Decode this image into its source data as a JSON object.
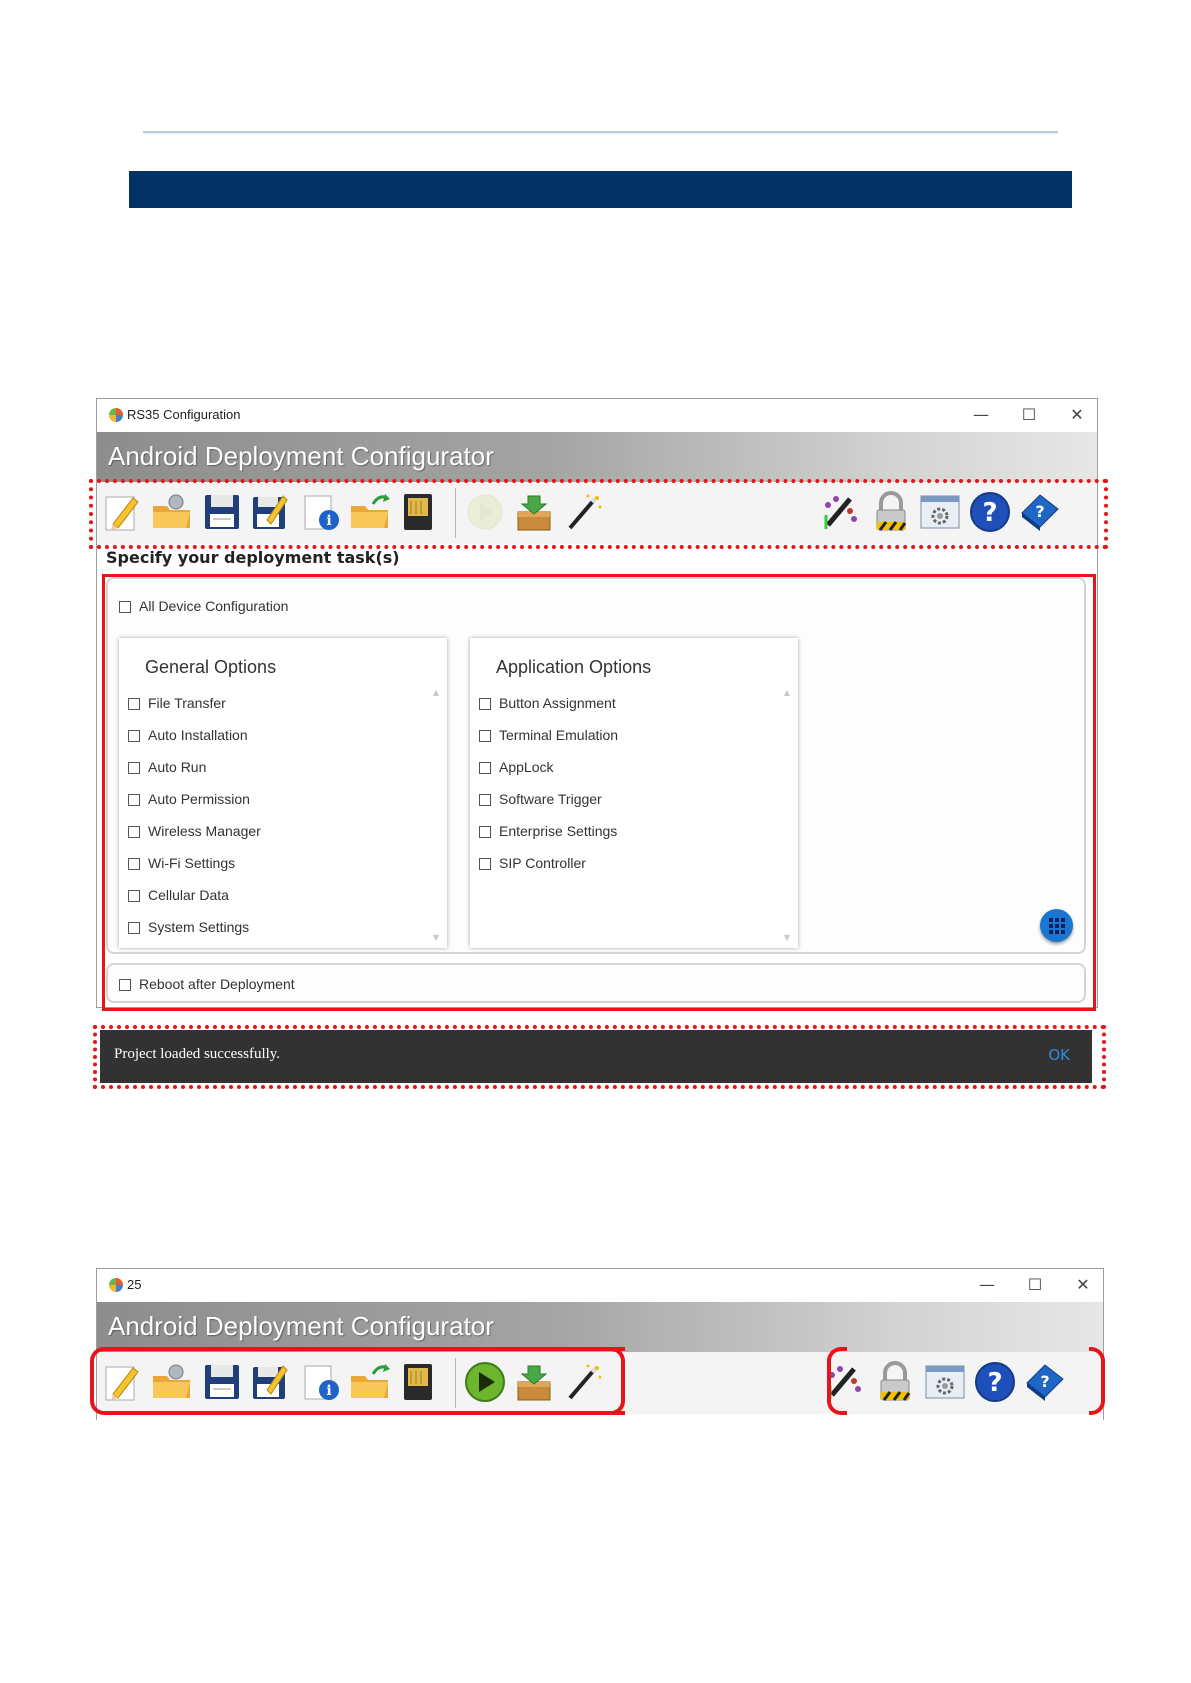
{
  "window1": {
    "title": "RS35 Configuration",
    "app_title": "Android Deployment Configurator",
    "controls": {
      "minimize": "—",
      "maximize": "☐",
      "close": "✕"
    },
    "section_label": "Specify your deployment task(s)",
    "all_device": "All Device Configuration",
    "general": {
      "title": "General Options",
      "items": [
        "File Transfer",
        "Auto Installation",
        "Auto Run",
        "Auto Permission",
        "Wireless Manager",
        "Wi-Fi Settings",
        "Cellular Data",
        "System Settings"
      ]
    },
    "application": {
      "title": "Application Options",
      "items": [
        "Button Assignment",
        "Terminal Emulation",
        "AppLock",
        "Software Trigger",
        "Enterprise Settings",
        "SIP Controller"
      ]
    },
    "reboot": "Reboot after Deployment",
    "run_button_enabled": false
  },
  "snackbar": {
    "message": "Project loaded successfully.",
    "action": "OK"
  },
  "window2": {
    "title": "25",
    "app_title": "Android Deployment Configurator",
    "controls": {
      "minimize": "—",
      "maximize": "☐",
      "close": "✕"
    },
    "run_button_enabled": true
  },
  "toolbar_icons": [
    "new-project-icon",
    "open-project-icon",
    "save-icon",
    "save-as-icon",
    "project-info-icon",
    "export-folder-icon",
    "sd-card-icon",
    "run-deployment-icon",
    "install-package-icon",
    "wizard-icon",
    "customize-toolbar-icon",
    "lock-icon",
    "settings-window-icon",
    "help-icon",
    "user-manual-icon"
  ],
  "colors": {
    "banner": "#023266",
    "highlight": "#e8141a",
    "snackbar": "#323232",
    "ok": "#2f8de4",
    "fab": "#1976d2"
  }
}
